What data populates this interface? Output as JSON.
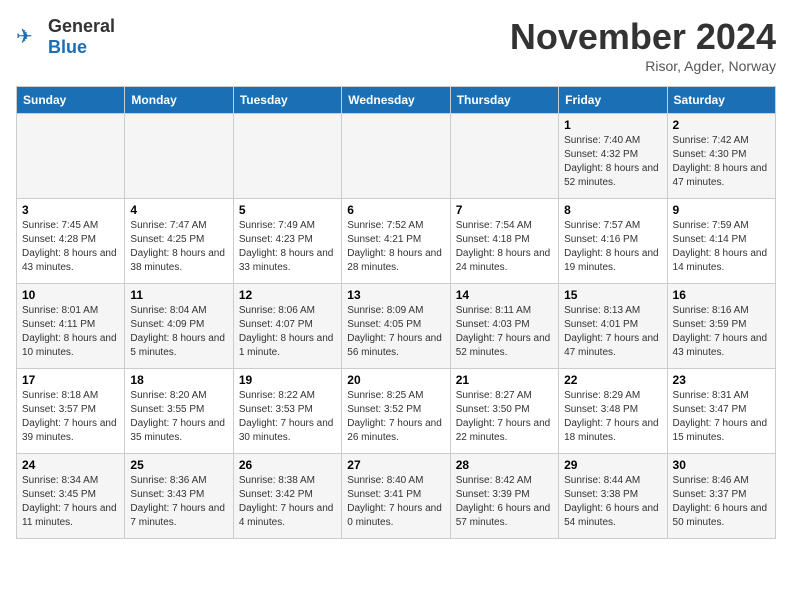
{
  "header": {
    "logo_general": "General",
    "logo_blue": "Blue",
    "month_title": "November 2024",
    "location": "Risor, Agder, Norway"
  },
  "days_of_week": [
    "Sunday",
    "Monday",
    "Tuesday",
    "Wednesday",
    "Thursday",
    "Friday",
    "Saturday"
  ],
  "weeks": [
    [
      {
        "day": "",
        "info": ""
      },
      {
        "day": "",
        "info": ""
      },
      {
        "day": "",
        "info": ""
      },
      {
        "day": "",
        "info": ""
      },
      {
        "day": "",
        "info": ""
      },
      {
        "day": "1",
        "info": "Sunrise: 7:40 AM\nSunset: 4:32 PM\nDaylight: 8 hours and 52 minutes."
      },
      {
        "day": "2",
        "info": "Sunrise: 7:42 AM\nSunset: 4:30 PM\nDaylight: 8 hours and 47 minutes."
      }
    ],
    [
      {
        "day": "3",
        "info": "Sunrise: 7:45 AM\nSunset: 4:28 PM\nDaylight: 8 hours and 43 minutes."
      },
      {
        "day": "4",
        "info": "Sunrise: 7:47 AM\nSunset: 4:25 PM\nDaylight: 8 hours and 38 minutes."
      },
      {
        "day": "5",
        "info": "Sunrise: 7:49 AM\nSunset: 4:23 PM\nDaylight: 8 hours and 33 minutes."
      },
      {
        "day": "6",
        "info": "Sunrise: 7:52 AM\nSunset: 4:21 PM\nDaylight: 8 hours and 28 minutes."
      },
      {
        "day": "7",
        "info": "Sunrise: 7:54 AM\nSunset: 4:18 PM\nDaylight: 8 hours and 24 minutes."
      },
      {
        "day": "8",
        "info": "Sunrise: 7:57 AM\nSunset: 4:16 PM\nDaylight: 8 hours and 19 minutes."
      },
      {
        "day": "9",
        "info": "Sunrise: 7:59 AM\nSunset: 4:14 PM\nDaylight: 8 hours and 14 minutes."
      }
    ],
    [
      {
        "day": "10",
        "info": "Sunrise: 8:01 AM\nSunset: 4:11 PM\nDaylight: 8 hours and 10 minutes."
      },
      {
        "day": "11",
        "info": "Sunrise: 8:04 AM\nSunset: 4:09 PM\nDaylight: 8 hours and 5 minutes."
      },
      {
        "day": "12",
        "info": "Sunrise: 8:06 AM\nSunset: 4:07 PM\nDaylight: 8 hours and 1 minute."
      },
      {
        "day": "13",
        "info": "Sunrise: 8:09 AM\nSunset: 4:05 PM\nDaylight: 7 hours and 56 minutes."
      },
      {
        "day": "14",
        "info": "Sunrise: 8:11 AM\nSunset: 4:03 PM\nDaylight: 7 hours and 52 minutes."
      },
      {
        "day": "15",
        "info": "Sunrise: 8:13 AM\nSunset: 4:01 PM\nDaylight: 7 hours and 47 minutes."
      },
      {
        "day": "16",
        "info": "Sunrise: 8:16 AM\nSunset: 3:59 PM\nDaylight: 7 hours and 43 minutes."
      }
    ],
    [
      {
        "day": "17",
        "info": "Sunrise: 8:18 AM\nSunset: 3:57 PM\nDaylight: 7 hours and 39 minutes."
      },
      {
        "day": "18",
        "info": "Sunrise: 8:20 AM\nSunset: 3:55 PM\nDaylight: 7 hours and 35 minutes."
      },
      {
        "day": "19",
        "info": "Sunrise: 8:22 AM\nSunset: 3:53 PM\nDaylight: 7 hours and 30 minutes."
      },
      {
        "day": "20",
        "info": "Sunrise: 8:25 AM\nSunset: 3:52 PM\nDaylight: 7 hours and 26 minutes."
      },
      {
        "day": "21",
        "info": "Sunrise: 8:27 AM\nSunset: 3:50 PM\nDaylight: 7 hours and 22 minutes."
      },
      {
        "day": "22",
        "info": "Sunrise: 8:29 AM\nSunset: 3:48 PM\nDaylight: 7 hours and 18 minutes."
      },
      {
        "day": "23",
        "info": "Sunrise: 8:31 AM\nSunset: 3:47 PM\nDaylight: 7 hours and 15 minutes."
      }
    ],
    [
      {
        "day": "24",
        "info": "Sunrise: 8:34 AM\nSunset: 3:45 PM\nDaylight: 7 hours and 11 minutes."
      },
      {
        "day": "25",
        "info": "Sunrise: 8:36 AM\nSunset: 3:43 PM\nDaylight: 7 hours and 7 minutes."
      },
      {
        "day": "26",
        "info": "Sunrise: 8:38 AM\nSunset: 3:42 PM\nDaylight: 7 hours and 4 minutes."
      },
      {
        "day": "27",
        "info": "Sunrise: 8:40 AM\nSunset: 3:41 PM\nDaylight: 7 hours and 0 minutes."
      },
      {
        "day": "28",
        "info": "Sunrise: 8:42 AM\nSunset: 3:39 PM\nDaylight: 6 hours and 57 minutes."
      },
      {
        "day": "29",
        "info": "Sunrise: 8:44 AM\nSunset: 3:38 PM\nDaylight: 6 hours and 54 minutes."
      },
      {
        "day": "30",
        "info": "Sunrise: 8:46 AM\nSunset: 3:37 PM\nDaylight: 6 hours and 50 minutes."
      }
    ]
  ]
}
